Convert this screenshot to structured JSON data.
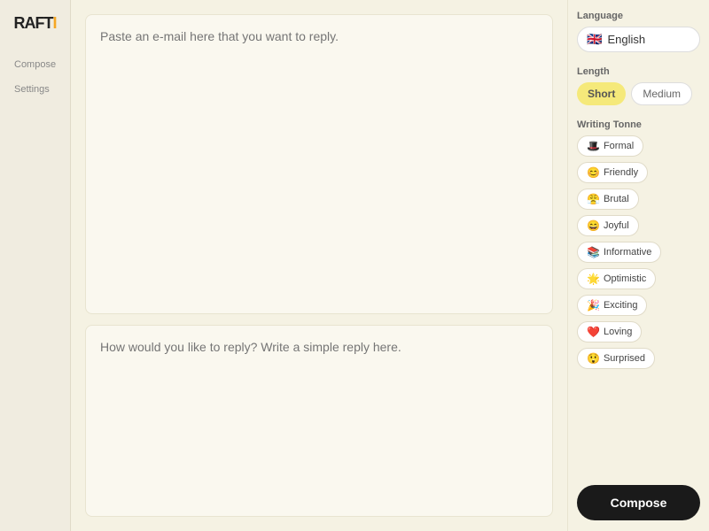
{
  "sidebar": {
    "logo": "RAFT",
    "logo_accent": "I",
    "items": [
      {
        "label": "Compose",
        "id": "compose"
      },
      {
        "label": "Settings",
        "id": "settings"
      }
    ]
  },
  "main": {
    "email_placeholder": "Paste an e-mail here that you want to reply.",
    "reply_placeholder": "How would you like to reply? Write a simple reply here."
  },
  "right_panel": {
    "language": {
      "label": "Language",
      "flag": "🇬🇧",
      "flag_code": "GB",
      "selected": "English"
    },
    "length": {
      "label": "Length",
      "options": [
        {
          "label": "Short",
          "active": true
        },
        {
          "label": "Medium",
          "active": false
        }
      ]
    },
    "writing_tonne": {
      "label": "Writing Tonne",
      "tones": [
        {
          "emoji": "🎩",
          "label": "Formal"
        },
        {
          "emoji": "😊",
          "label": "Friendly"
        },
        {
          "emoji": "😤",
          "label": "Brutal"
        },
        {
          "emoji": "😄",
          "label": "Joyful"
        },
        {
          "emoji": "📚",
          "label": "Informative"
        },
        {
          "emoji": "🌟",
          "label": "Optimistic"
        },
        {
          "emoji": "🎉",
          "label": "Exciting"
        },
        {
          "emoji": "❤️",
          "label": "Loving"
        },
        {
          "emoji": "😲",
          "label": "Surprised"
        }
      ]
    },
    "compose_button": "Compose"
  }
}
